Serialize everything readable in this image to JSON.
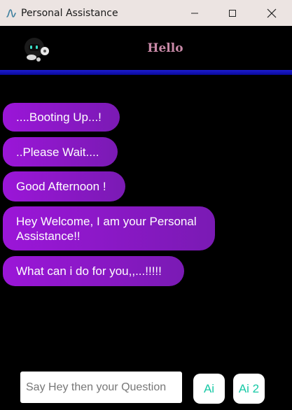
{
  "window": {
    "title": "Personal Assistance"
  },
  "header": {
    "title": "Hello"
  },
  "messages": [
    "....Booting Up...!",
    "..Please Wait....",
    "Good Afternoon !",
    "Hey Welcome, I am your Personal Assistance!!",
    "What can i do for you,,...!!!!!"
  ],
  "input": {
    "placeholder": "Say Hey then your Question"
  },
  "buttons": {
    "ai_label": "Ai",
    "ai2_label": "Ai 2"
  },
  "colors": {
    "bubble": "#9b16d8",
    "header_title": "#c98aa8",
    "header_bar": "#1c1ccf",
    "button_text": "#18c9a6"
  }
}
